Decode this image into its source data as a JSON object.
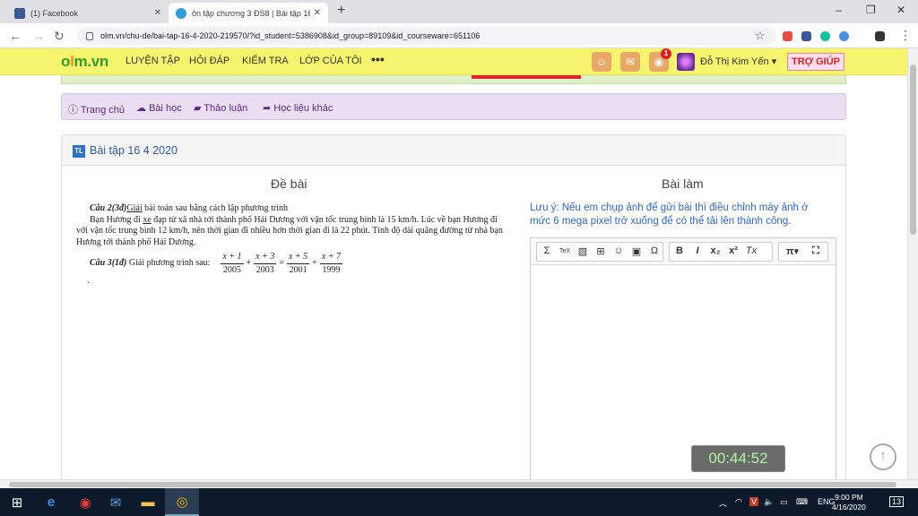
{
  "browser": {
    "tabs": [
      {
        "label": "(1) Facebook",
        "icon": "facebook-icon",
        "color": "#3b5998"
      },
      {
        "label": "ôn tập chương 3 ĐS8 | Bài tập 16",
        "icon": "cloud-icon",
        "color": "#2f9edb"
      }
    ],
    "new_tab": "+",
    "url": "olm.vn/chu-de/bai-tap-16-4-2020-219570/?id_student=5386908&id_group=89109&id_courseware=651106",
    "controls": {
      "minimize": "–",
      "maximize": "❐",
      "close": "✕"
    }
  },
  "site": {
    "logo": {
      "a": "o",
      "dot": "l",
      "b": "m.vn"
    },
    "nav": [
      "LUYỆN TẬP",
      "HỎI ĐÁP",
      "KIỂM TRA",
      "LỚP CỦA TÔI"
    ],
    "more": "•••",
    "notification_count": "1",
    "user_name": "Đỗ Thị Kim Yến",
    "help": "TRỢ GIÚP",
    "accent": "#f7f46d"
  },
  "course_nav": [
    {
      "icon": "info-icon",
      "label": "Trang chủ"
    },
    {
      "icon": "chat-icon",
      "label": "Bài học"
    },
    {
      "icon": "book-icon",
      "label": "Thảo luận"
    },
    {
      "icon": "share-icon",
      "label": "Học liệu khác"
    }
  ],
  "panel": {
    "tag": "TL",
    "title": "Bài tập 16 4 2020",
    "problem_heading": "Đề bài",
    "answer_heading": "Bài làm"
  },
  "problem": {
    "q2_label": "Câu 2(3đ)",
    "q2_task": "Giải",
    "q2_rest": " bài toán sau bằng cách lập phương trình",
    "q2_body_a": "Bạn Hương đi ",
    "q2_body_underline": "xe",
    "q2_body_b": " đạp từ xã nhà tới thành phố Hải Dương với vận tốc trung bình là 15 km/h. Lúc về bạn Hương đi với vận tốc trung bình 12 km/h, nên thời gian đi nhiều hơn thời gian đi là 22 phút. Tính độ dài quãng đường từ nhà bạn Hương tới thành phố Hải Dương.",
    "q3_label": "Câu 3(1đ)",
    "q3_rest": " Giải phương trình sau:",
    "fractions": [
      {
        "num": "x + 1",
        "den": "2005"
      },
      {
        "num": "x + 3",
        "den": "2003"
      },
      {
        "num": "x + 5",
        "den": "2001"
      },
      {
        "num": "x + 7",
        "den": "1999"
      }
    ],
    "ops": [
      "+",
      "=",
      "+"
    ],
    "stray_mark": "."
  },
  "answer": {
    "note": "Lưu ý: Nếu em chụp ảnh để gửi bài thì điều chỉnh máy ảnh ở mức 6 mega pixel trở xuống để có thể tải lên thành công.",
    "toolbar": [
      "Σ",
      "TeX",
      "▧",
      "⊞",
      "☺",
      "▣",
      "Ω",
      "B",
      "I",
      "x₂",
      "x²",
      "Tx",
      "π▾",
      "⛶"
    ]
  },
  "timer": "00:44:52",
  "taskbar": {
    "lang": "ENG",
    "time": "9:00 PM",
    "date": "4/16/2020",
    "notifications": "13"
  }
}
